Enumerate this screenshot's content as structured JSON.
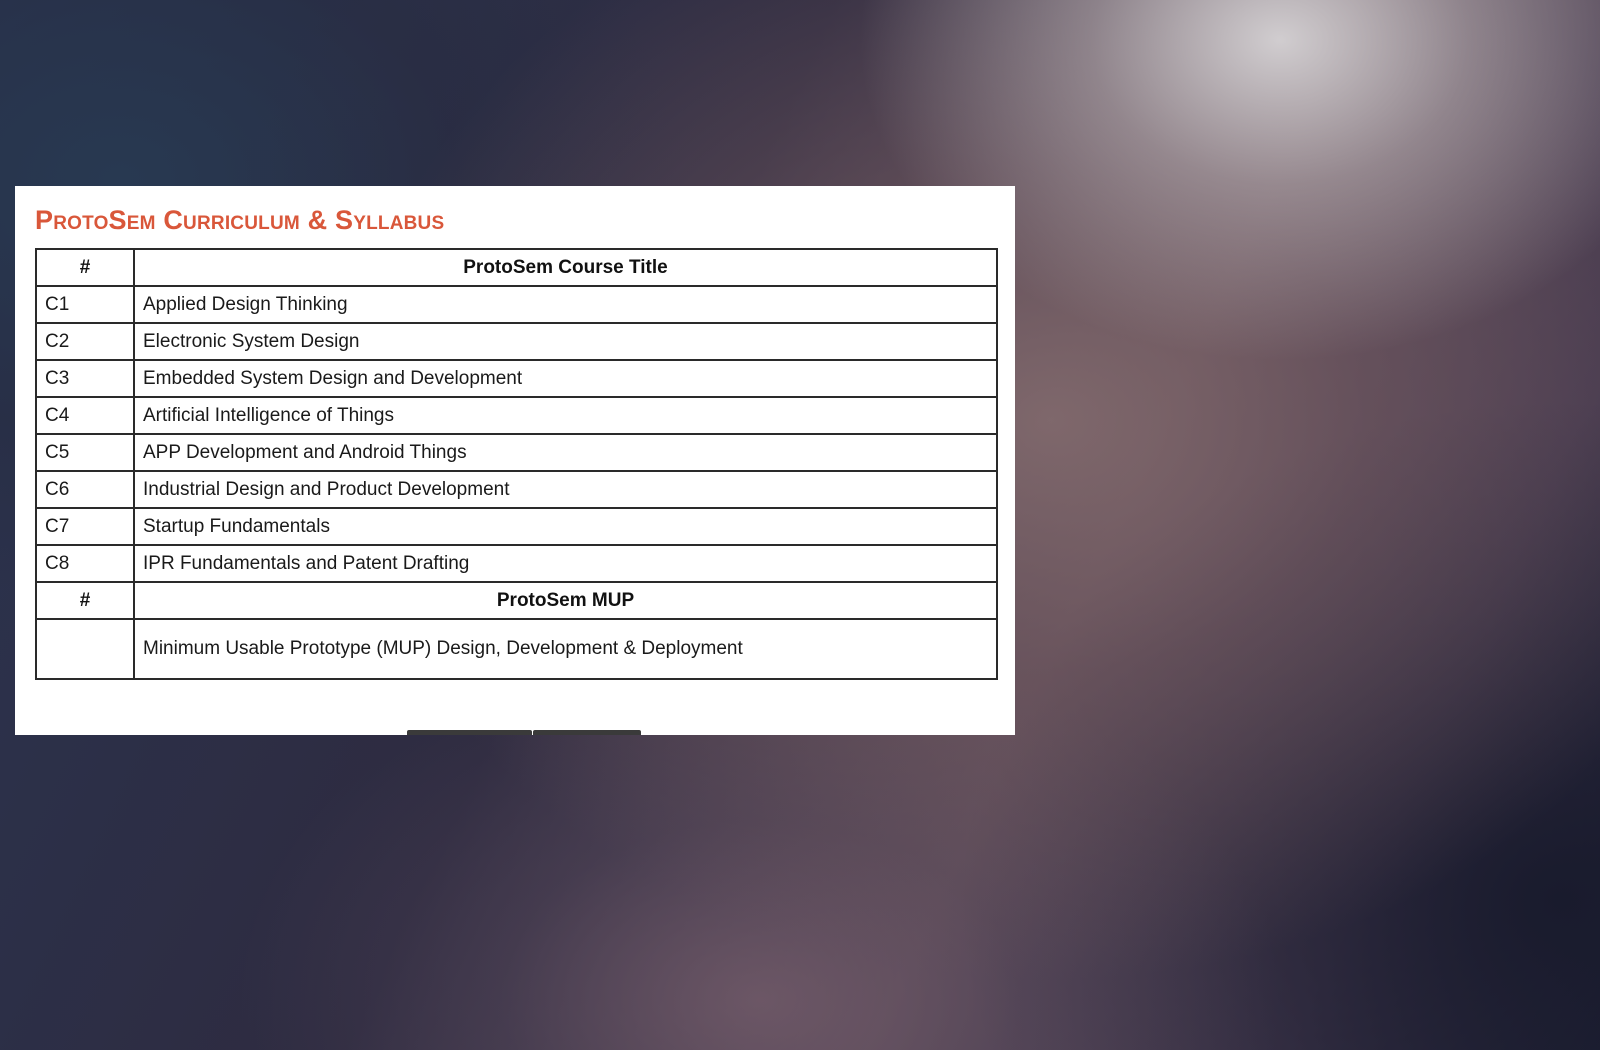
{
  "slide": {
    "title": "ProtoSem Curriculum & Syllabus",
    "title_color": "#d9573a"
  },
  "course_table": {
    "headers": {
      "num": "#",
      "title": "ProtoSem Course Title"
    },
    "rows": [
      {
        "id": "C1",
        "title": "Applied Design Thinking"
      },
      {
        "id": "C2",
        "title": "Electronic System Design"
      },
      {
        "id": "C3",
        "title": "Embedded System Design and Development"
      },
      {
        "id": "C4",
        "title": "Artificial Intelligence of Things"
      },
      {
        "id": "C5",
        "title": "APP Development and Android Things"
      },
      {
        "id": "C6",
        "title": "Industrial Design and Product Development"
      },
      {
        "id": "C7",
        "title": "Startup Fundamentals"
      },
      {
        "id": "C8",
        "title": "IPR Fundamentals and Patent Drafting"
      }
    ]
  },
  "mup_table": {
    "headers": {
      "num": "#",
      "title": "ProtoSem MUP"
    },
    "rows": [
      {
        "id": "",
        "title": "Minimum Usable Prototype (MUP) Design, Development & Deployment"
      }
    ]
  }
}
